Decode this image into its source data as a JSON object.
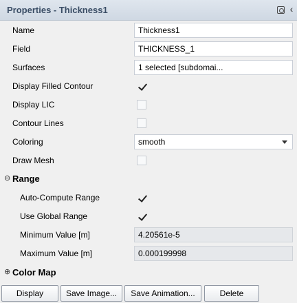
{
  "panel": {
    "title": "Properties - Thickness1"
  },
  "properties": {
    "name": {
      "label": "Name",
      "value": "Thickness1"
    },
    "field": {
      "label": "Field",
      "value": "THICKNESS_1"
    },
    "surfaces": {
      "label": "Surfaces",
      "value": "1 selected [subdomai..."
    },
    "display_filled_contour": {
      "label": "Display Filled Contour",
      "checked": true
    },
    "display_lic": {
      "label": "Display LIC",
      "checked": false
    },
    "contour_lines": {
      "label": "Contour Lines",
      "checked": false
    },
    "coloring": {
      "label": "Coloring",
      "value": "smooth"
    },
    "draw_mesh": {
      "label": "Draw Mesh",
      "checked": false
    }
  },
  "range": {
    "section_title": "Range",
    "expanded": true,
    "auto_compute": {
      "label": "Auto-Compute Range",
      "checked": true
    },
    "use_global": {
      "label": "Use Global Range",
      "checked": true
    },
    "minimum": {
      "label": "Minimum Value [m]",
      "value": "4.20561e-5"
    },
    "maximum": {
      "label": "Maximum Value [m]",
      "value": "0.000199998"
    }
  },
  "color_map": {
    "section_title": "Color Map",
    "expanded": false
  },
  "buttons": {
    "display": "Display",
    "save_image": "Save Image...",
    "save_animation": "Save Animation...",
    "delete": "Delete"
  }
}
